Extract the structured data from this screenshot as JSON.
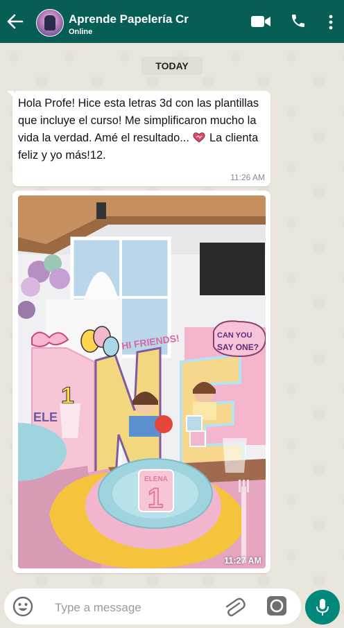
{
  "header": {
    "contact_name": "Aprende Papelería Cr",
    "status": "Online"
  },
  "date_chip": "TODAY",
  "messages": [
    {
      "text": "Hola Profe! Hice esta letras 3d con las plantillas que incluye el curso! Me simplificaron mucho la vida la verdad. Amé el resultado...",
      "text_after_emoji": "La clienta feliz y yo más!12.",
      "emoji": "heart-emoji",
      "time": "11:26 AM"
    },
    {
      "type": "image",
      "photo_texts": [
        "HI FRIENDS!",
        "CAN YOU SAY ONE?",
        "ELENA",
        "1"
      ],
      "time": "11:27 AM"
    }
  ],
  "composer": {
    "placeholder": "Type a message"
  },
  "colors": {
    "header": "#075e54",
    "mic_button": "#00897b",
    "bubble": "#ffffff"
  }
}
